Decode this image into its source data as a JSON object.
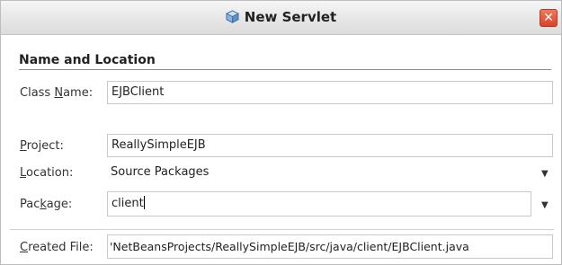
{
  "window": {
    "title": "New Servlet",
    "close_glyph": "✕"
  },
  "section": {
    "title": "Name and Location"
  },
  "fields": {
    "class_name": {
      "label_pre": "Class ",
      "label_mnemonic": "N",
      "label_post": "ame:",
      "value": "EJBClient"
    },
    "project": {
      "label_pre": "",
      "label_mnemonic": "P",
      "label_post": "roject:",
      "value": "ReallySimpleEJB"
    },
    "location": {
      "label_pre": "",
      "label_mnemonic": "L",
      "label_post": "ocation:",
      "value": "Source Packages"
    },
    "package": {
      "label_pre": "Pac",
      "label_mnemonic": "k",
      "label_post": "age:",
      "value": "client"
    },
    "created_file": {
      "label_pre": "",
      "label_mnemonic": "C",
      "label_post": "reated File:",
      "value": "'NetBeansProjects/ReallySimpleEJB/src/java/client/EJBClient.java"
    }
  },
  "icons": {
    "title_icon": "cube-icon",
    "dropdown_arrow": "▼"
  }
}
